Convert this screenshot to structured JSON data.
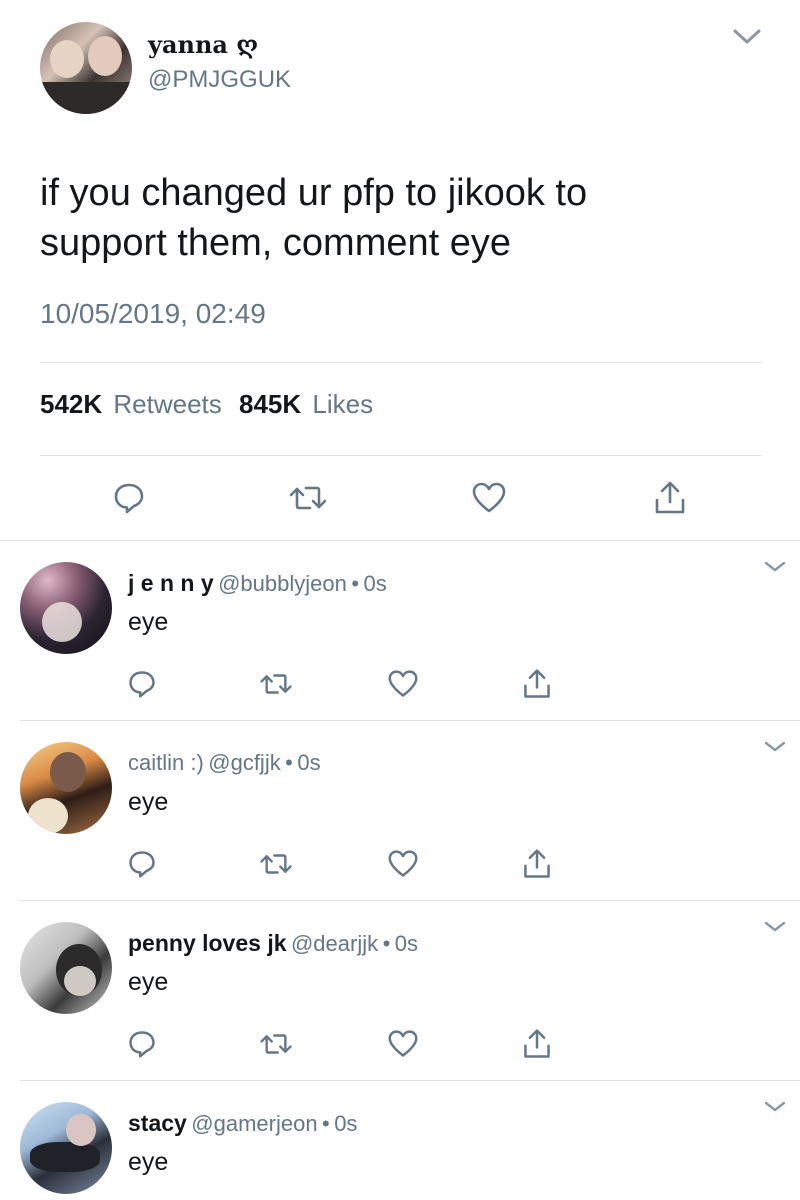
{
  "tweet": {
    "display_name": "yanna ღ",
    "handle": "@PMJGGUK",
    "text_line1": "if you changed ur pfp to jikook to",
    "text_line2": "support them, comment eye",
    "timestamp": "10/05/2019, 02:49",
    "retweets_count": "542K",
    "retweets_label": "Retweets",
    "likes_count": "845K",
    "likes_label": "Likes"
  },
  "replies": [
    {
      "name": "j e n n y",
      "handle": "@bubblyjeon",
      "sep": "•",
      "time": "0s",
      "text": "eye"
    },
    {
      "name": "caitlin :)",
      "handle": "@gcfjjk",
      "sep": "•",
      "time": "0s",
      "text": "eye"
    },
    {
      "name": "penny loves jk",
      "handle": "@dearjjk",
      "sep": "•",
      "time": "0s",
      "text": "eye"
    },
    {
      "name": "stacy",
      "handle": "@gamerjeon",
      "sep": "•",
      "time": "0s",
      "text": "eye"
    }
  ],
  "icons": {
    "reply": "speech-bubble-icon",
    "retweet": "retweet-arrows-icon",
    "like": "heart-icon",
    "share": "share-upload-icon",
    "menu": "chevron-down-icon"
  },
  "colors": {
    "text": "#14171a",
    "secondary": "#657786",
    "divider": "#dfe3e6",
    "icon": "#657786"
  }
}
